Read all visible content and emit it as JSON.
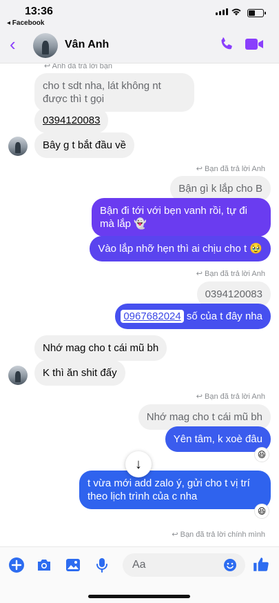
{
  "status_bar": {
    "time": "13:36",
    "back_app": "◂ Facebook"
  },
  "header": {
    "contact_name": "Vân Anh"
  },
  "messages": {
    "m1_reply_note": "↩ Anh đã trả lời bạn",
    "m1_quoted": "cho t sdt nha, lát không nt được thì t gọi",
    "m1_text": "0394120083",
    "m2_text": "Bây g t bắt đầu về",
    "m3_reply_note": "↩ Bạn đã trả lời Anh",
    "m3_quoted": "Bận gì k lắp cho B",
    "m3_text": "Bận đi tới với bẹn vanh rồi, tự đi mà lắp 👻",
    "m4_text": "Vào lắp nhỡ hẹn thì ai chịu cho t 🥹",
    "m5_reply_note": "↩ Bạn đã trả lời Anh",
    "m5_quoted": "0394120083",
    "m5_link": "0967682024",
    "m5_rest": " số của t đây nha",
    "m6_text": "Nhớ mag cho t cái mũ bh",
    "m7_text": "K thì ăn shit đấy",
    "m8_reply_note": "↩ Bạn đã trả lời Anh",
    "m8_quoted": "Nhớ mag cho t cái mũ bh",
    "m8_text": "Yên tâm, k xoè đâu",
    "m8_reaction": "😆",
    "m9_text": "t vừa mới add zalo ý, gửi cho t vị trí theo lịch trình của c nha",
    "m9_reaction": "😆",
    "m10_reply_note": "↩ Bạn đã trả lời chính mình"
  },
  "composer": {
    "placeholder": "Aa"
  },
  "colors": {
    "accent": "#8a3ffc",
    "bubble_out_top": "#6a3cf0",
    "bubble_out_bottom": "#2f63ee",
    "bubble_in": "#f0f0f0"
  }
}
